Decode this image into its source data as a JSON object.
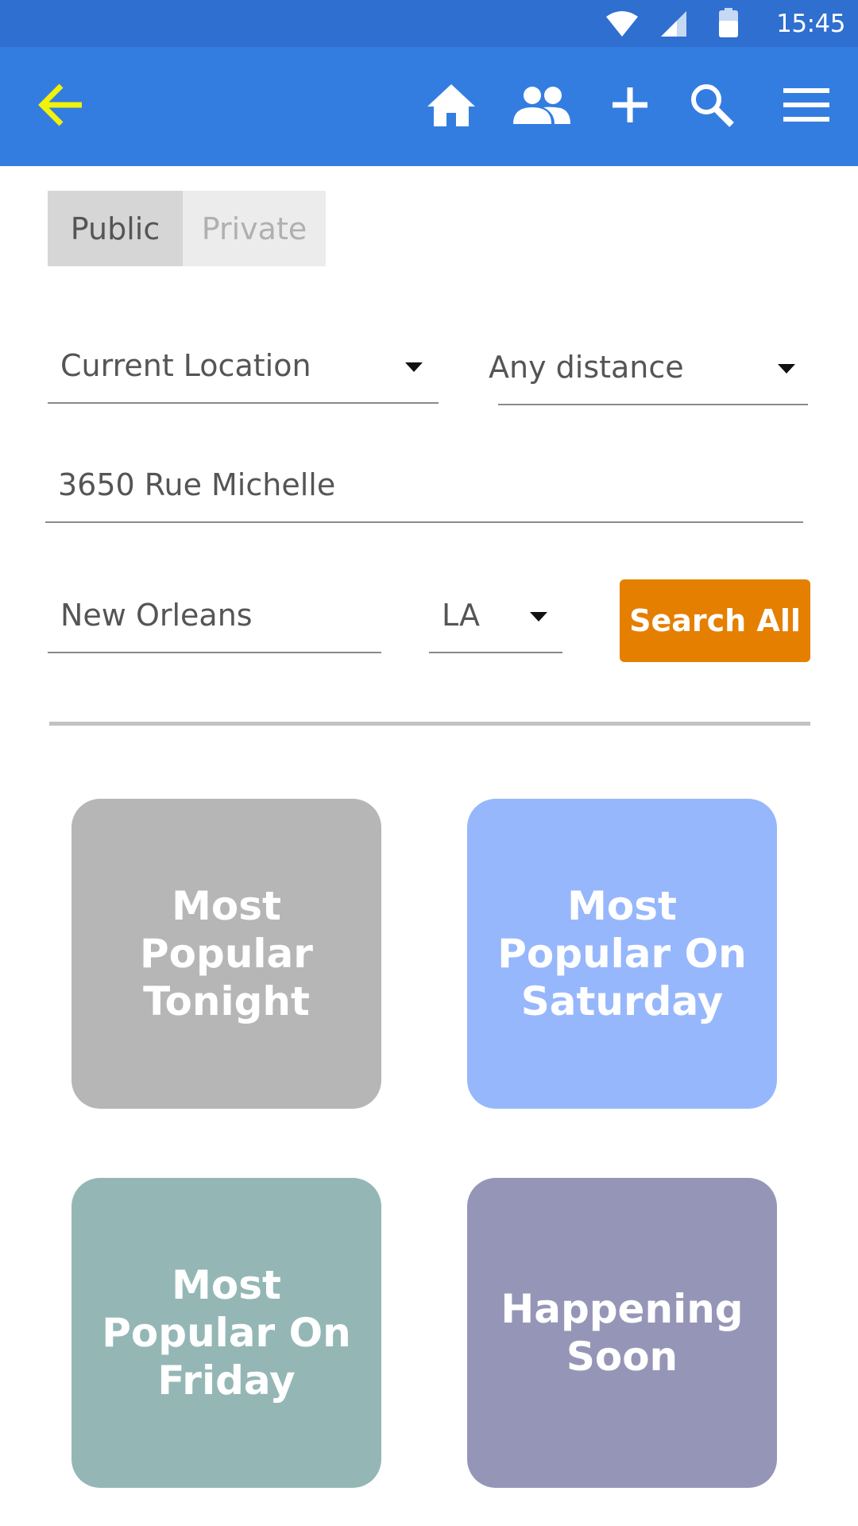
{
  "status_bar": {
    "time": "15:45",
    "icons": [
      "wifi-icon",
      "cell-signal-icon",
      "battery-icon"
    ]
  },
  "app_bar": {
    "back_icon": "arrow-left-icon",
    "actions": [
      "home-icon",
      "people-icon",
      "plus-icon",
      "search-icon",
      "menu-icon"
    ]
  },
  "visibility_toggle": {
    "options": [
      "Public",
      "Private"
    ],
    "selected": "Public"
  },
  "filters": {
    "location": "Current Location",
    "distance": "Any distance",
    "street": "3650 Rue Michelle",
    "city": "New Orleans",
    "state": "LA"
  },
  "search_button": {
    "label": "Search All"
  },
  "tiles": [
    {
      "label": "Most Popular Tonight",
      "color": "#b6b6b6"
    },
    {
      "label": "Most Popular On Saturday",
      "color": "#97b7fc"
    },
    {
      "label": "Most Popular On Friday",
      "color": "#94b7b6"
    },
    {
      "label": "Happening Soon",
      "color": "#9596b7"
    }
  ],
  "colors": {
    "status_bar": "#2e6fd0",
    "app_bar": "#347de0",
    "back_icon": "#f2f20a",
    "search_button": "#e57f00"
  }
}
